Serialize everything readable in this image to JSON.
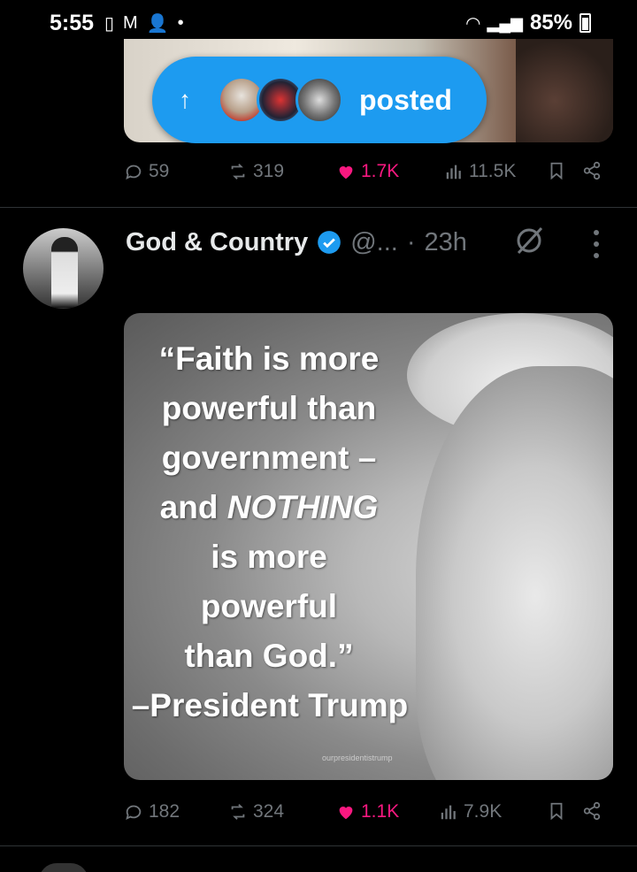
{
  "status_bar": {
    "time": "5:55",
    "battery": "85%"
  },
  "toast": {
    "arrow": "↑",
    "text": "posted"
  },
  "prev_tweet": {
    "replies": "59",
    "reposts": "319",
    "likes": "1.7K",
    "views": "11.5K"
  },
  "tweet": {
    "author": "God & Country",
    "handle": "@...",
    "separator": "·",
    "time": "23h",
    "image_text": {
      "l1": "“Faith is more",
      "l2": "powerful than",
      "l3": "government –",
      "l4a": "and ",
      "l4b": "NOTHING",
      "l5": "is more",
      "l6": "powerful",
      "l7": "than God.”",
      "l8": "–President Trump",
      "watermark": "ourpresidentistrump"
    },
    "replies": "182",
    "reposts": "324",
    "likes": "1.1K",
    "views": "7.9K"
  },
  "colors": {
    "accent": "#1d9bf0",
    "like": "#f91880",
    "muted": "#71767b"
  },
  "icons": [
    "reply-icon",
    "repost-icon",
    "like-icon",
    "views-icon",
    "bookmark-icon",
    "share-icon",
    "verified-icon",
    "grok-icon",
    "more-icon"
  ]
}
